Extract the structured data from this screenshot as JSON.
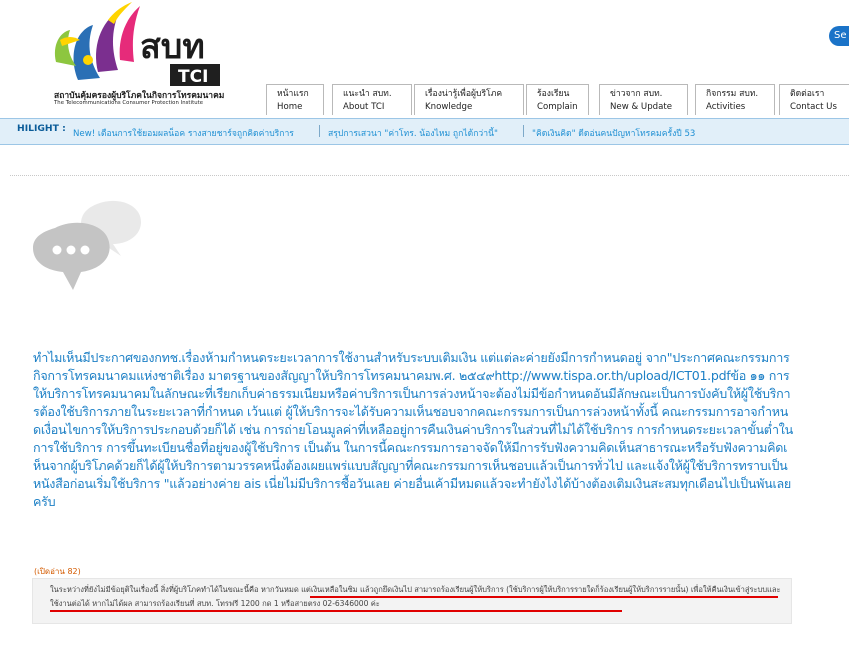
{
  "header": {
    "logo": {
      "brand_thai": "สบท",
      "brand_en": "TCI",
      "org_name_thai": "สถาบันคุ้มครองผู้บริโภคในกิจการโทรคมนาคม",
      "org_name_en": "The Telecommunications Consumer Protection Institute",
      "colors": {
        "blue": "#2a6fb5",
        "purple": "#7b2f8f",
        "green": "#8dc63f",
        "yellow": "#ffd400",
        "pink": "#e62b7a"
      }
    },
    "search_label": "Se",
    "nav": [
      {
        "thai": "หน้าแรก",
        "en": "Home"
      },
      {
        "thai": "แนะนำ สบท.",
        "en": "About TCI"
      },
      {
        "thai": "เรื่องน่ารู้เพื่อผู้บริโภค",
        "en": "Knowledge"
      },
      {
        "thai": "ร้องเรียน",
        "en": "Complain"
      },
      {
        "thai": "ข่าวจาก สบท.",
        "en": "New & Update"
      },
      {
        "thai": "กิจกรรม สบท.",
        "en": "Activities"
      },
      {
        "thai": "ติดต่อเรา",
        "en": "Contact Us"
      }
    ]
  },
  "hilight": {
    "label": "HILIGHT :",
    "items": [
      "New! เตือนการใช้ยอมผลน็อค รางสายชาร์จถูกคิดค่าบริการ",
      "สรุปการเสวนา \"ค่าโทร. น้องไหม ถูกได้กว่านี้\"",
      "\"คิดเงินคิด\" ดีดอ่นคนปัญหาโทรคมครั้งปี 53"
    ],
    "colors": {
      "bg": "#e1eff9",
      "label": "#0b5c99",
      "link": "#1e8fd3"
    }
  },
  "post": {
    "icon": "chat-bubbles-icon",
    "question": "ทำไมเห็นมีประกาศของกทช.เรื่องห้ามกำหนดระยะเวลาการใช้งานสำหรับระบบเติมเงิน แต่แต่ละค่ายยังมีการกำหนดอยู่ จาก\"ประกาศคณะกรรมการกิจการโทรคมนาคมแห่งชาติเรื่อง มาตรฐานของสัญญาให้บริการโทรคมนาคมพ.ศ. ๒๕๔๙http://www.tispa.or.th/upload/ICT01.pdfข้อ ๑๑ การให้บริการโทรคมนาคมในลักษณะที่เรียกเก็บค่าธรรมเนียมหรือค่าบริการเป็นการล่วงหน้าจะต้องไม่มีข้อกำหนดอันมีลักษณะเป็นการบังคับให้ผู้ใช้บริการต้องใช้บริการภายในระยะเวลาที่กำหนด เว้นแต่ ผู้ให้บริการจะได้รับความเห็นชอบจากคณะกรรมการเป็นการล่วงหน้าทั้งนี้ คณะกรรมการอาจกำหนดเงื่อนไขการให้บริการประกอบด้วยก็ได้ เช่น การถ่ายโอนมูลค่าที่เหลืออยู่การคืนเงินค่าบริการในส่วนที่ไม่ได้ใช้บริการ การกำหนดระยะเวลาขั้นต่ำในการใช้บริการ การขึ้นทะเบียนชื่อที่อยู่ของผู้ใช้บริการ เป็นต้น ในการนี้คณะกรรมการอาจจัดให้มีการรับฟังความคิดเห็นสาธารณะหรือรับฟังความคิดเห็นจากผู้บริโภคด้วยก็ได้ผู้ให้บริการตามวรรคหนึ่งต้องเผยแพร่แบบสัญญาที่คณะกรรมการเห็นชอบแล้วเป็นการทั่วไป และแจ้งให้ผู้ใช้บริการทราบเป็นหนังสือก่อนเริ่มใช้บริการ \"แล้วอย่างค่าย ais เนี่ยไม่มีบริการชื้อวันเลย ค่ายอื่นเค้ามีหมดแล้วจะทำยังไงได้บ้างต้องเติมเงินสะสมทุกเดือนไปเป็นพันเลยครับ",
    "view_count": "(เปิดอ่าน 82)",
    "answer": "ในระหว่างที่ยังไม่มีข้อยุติในเรื่องนี้ สิ่งที่ผู้บริโภคทำได้ในขณะนี้คือ หากวันหมด แต่เงินเหลือในซิม แล้วถูกยึดเงินไป สามารถร้องเรียนผู้ให้บริการ (ใช้บริการผู้ให้บริการรายใดก็ร้องเรียนผู้ให้บริการรายนั้น) เพื่อให้คืนเงินเข้าสู่ระบบและใช้งานต่อได้ หากไม่ได้ผล สามารถร้องเรียนที่ สบท. โทรฟรี 1200 กด 1 หรือสายตรง 02-6346000 ค่ะ",
    "colors": {
      "question": "#1d80c6",
      "view_count": "#d45b00",
      "answer": "#444444",
      "underline": "#e00000"
    }
  }
}
